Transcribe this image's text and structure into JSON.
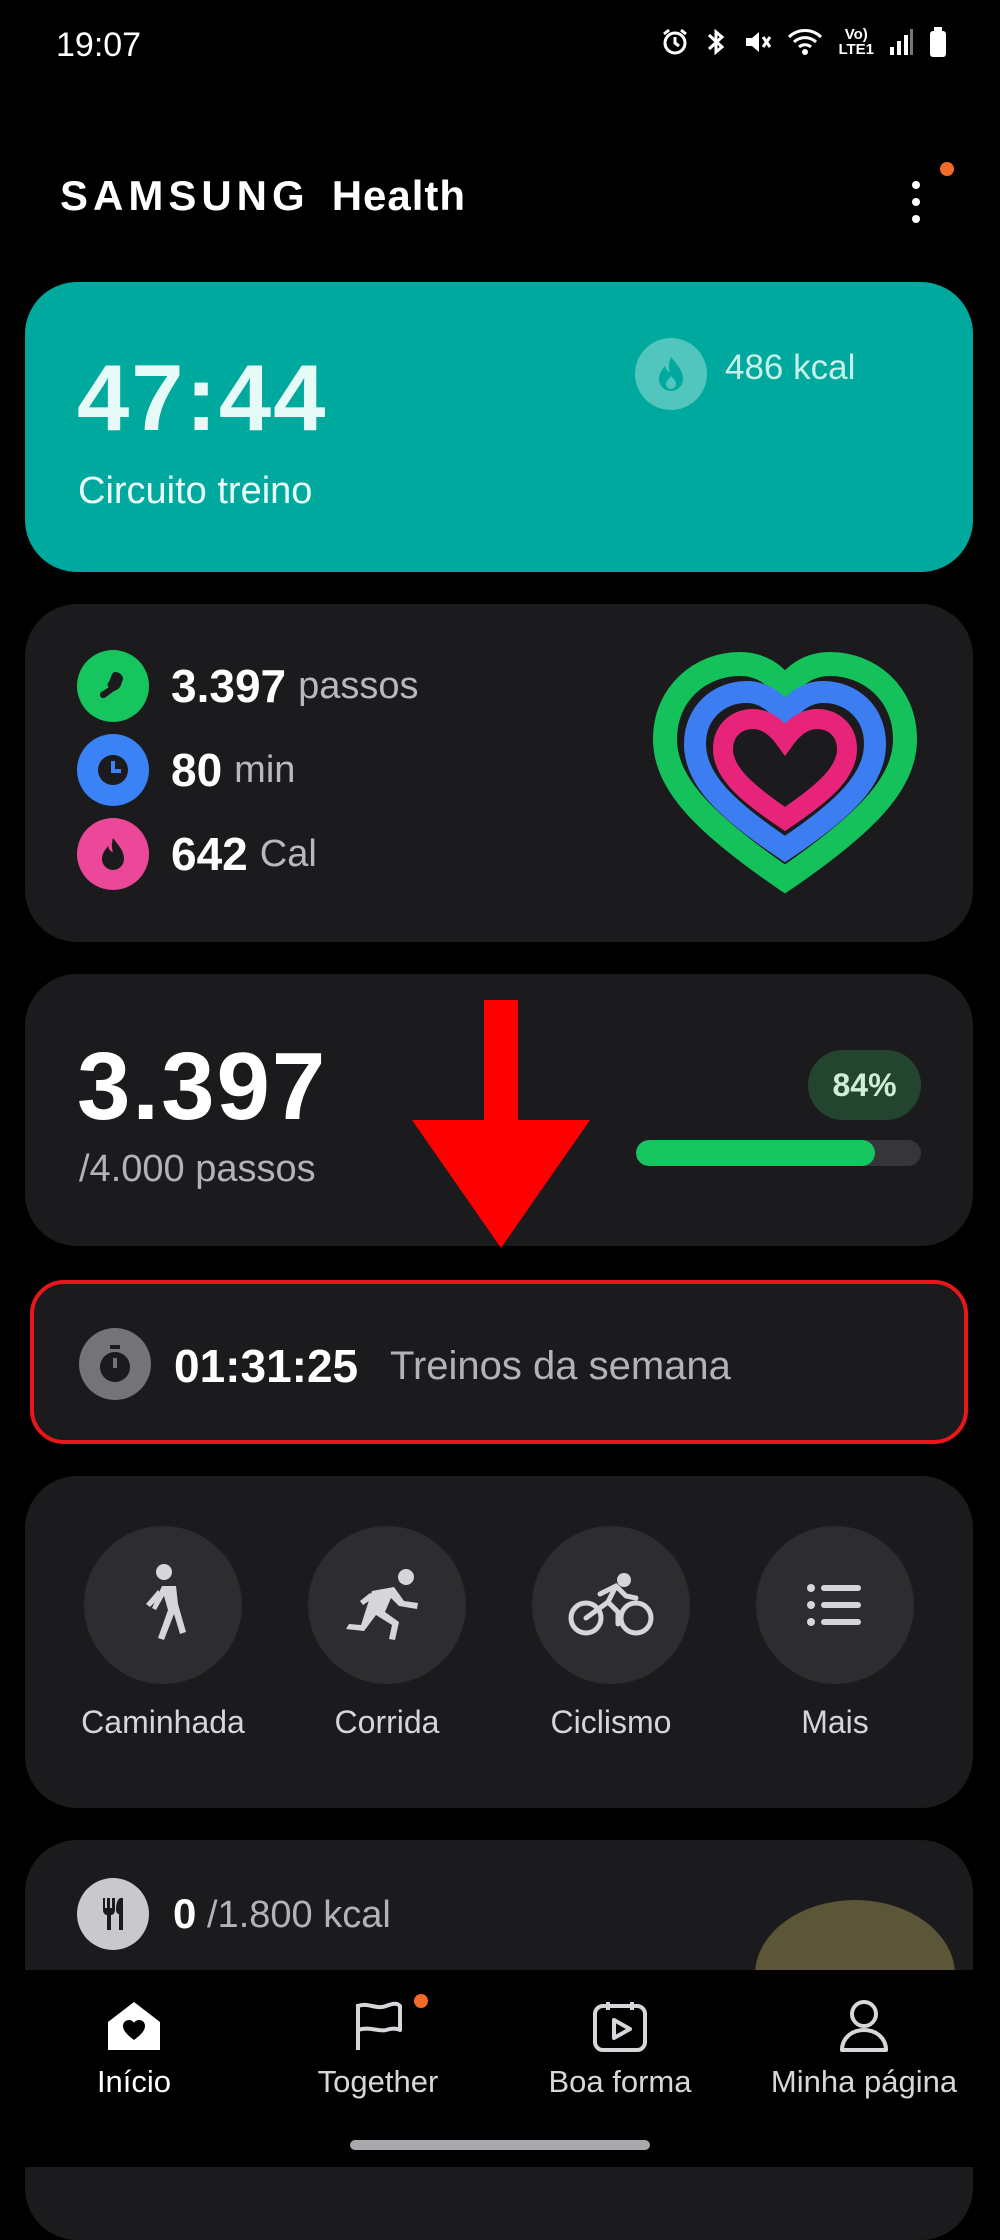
{
  "status_bar": {
    "time": "19:07",
    "network_label": "Vo)\nLTE1"
  },
  "header": {
    "brand": "SAMSUNG",
    "title": "Health"
  },
  "workout": {
    "duration": "47:44",
    "name": "Circuito treino",
    "calories": "486 kcal"
  },
  "activity": {
    "steps": {
      "value": "3.397",
      "unit": "passos"
    },
    "minutes": {
      "value": "80",
      "unit": "min"
    },
    "calories": {
      "value": "642",
      "unit": "Cal"
    }
  },
  "steps_goal": {
    "value": "3.397",
    "goal": "/4.000 passos",
    "percent_label": "84%",
    "progress": 0.84
  },
  "weekly": {
    "time": "01:31:25",
    "label": "Treinos da semana"
  },
  "shortcuts": [
    {
      "label": "Caminhada",
      "icon": "walk-icon"
    },
    {
      "label": "Corrida",
      "icon": "run-icon"
    },
    {
      "label": "Ciclismo",
      "icon": "bike-icon"
    },
    {
      "label": "Mais",
      "icon": "list-icon"
    }
  ],
  "food": {
    "value": "0",
    "goal": "/1.800 kcal"
  },
  "nav": [
    {
      "label": "Início",
      "icon": "home-icon"
    },
    {
      "label": "Together",
      "icon": "flag-icon"
    },
    {
      "label": "Boa forma",
      "icon": "video-calendar-icon"
    },
    {
      "label": "Minha página",
      "icon": "person-icon"
    }
  ],
  "colors": {
    "workout_bg": "#00a99d",
    "steps_green": "#16c55e",
    "minutes_blue": "#3b82f6",
    "calories_pink": "#ec4899",
    "highlight_red": "#e8171b",
    "notification_orange": "#f26b2a"
  }
}
